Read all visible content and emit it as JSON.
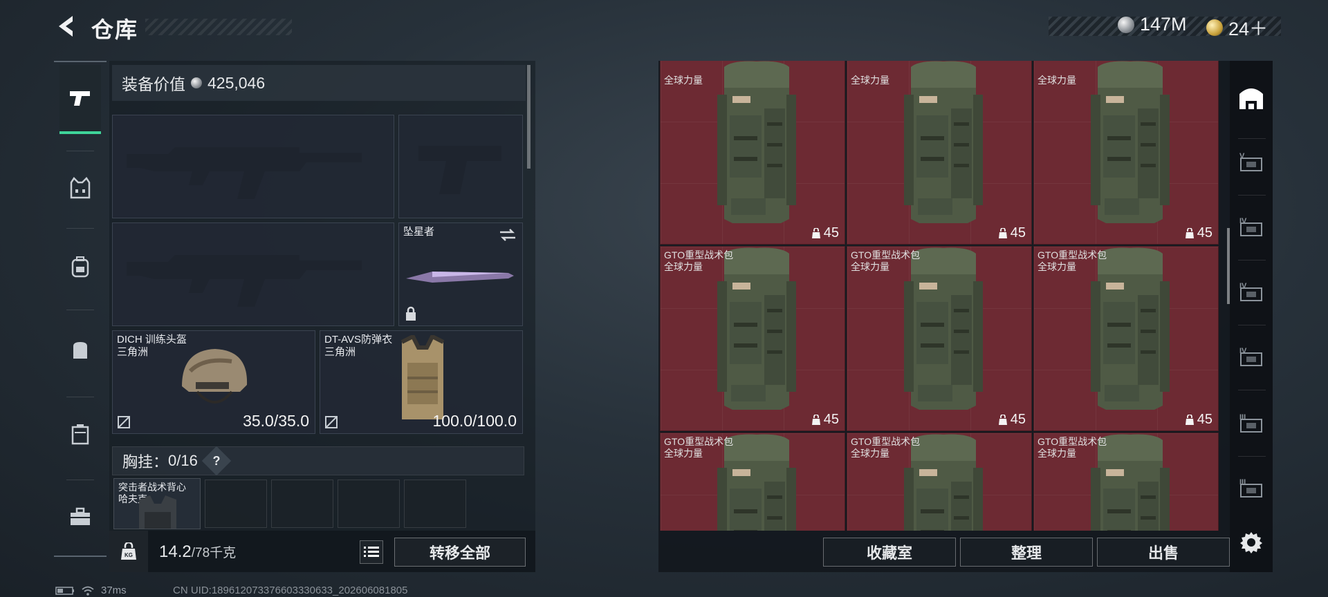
{
  "header": {
    "title": "仓库",
    "currency_1": "147M",
    "currency_2": "24＋"
  },
  "equipment": {
    "value_label": "装备价值",
    "value": "425,046",
    "melee_name": "坠星者",
    "helmet_name": "DICH 训练头盔",
    "helmet_origin": "三角洲",
    "helmet_durability": "35.0/35.0",
    "armor_name": "DT-AVS防弹衣",
    "armor_origin": "三角洲",
    "armor_durability": "100.0/100.0",
    "chest_rig_label": "胸挂：",
    "chest_rig_capacity": "0/16",
    "chest_rig_help": "?",
    "vest_name": "突击者战术背心",
    "vest_origin": "哈夫克"
  },
  "weight": {
    "current": "14.2",
    "max": "/78千克"
  },
  "actions": {
    "transfer_all": "转移全部",
    "collection_room": "收藏室",
    "organize": "整理",
    "sell": "出售"
  },
  "storage": {
    "item_name": "GTO重型战术包",
    "item_origin": "全球力量",
    "item_count": "45",
    "cells": [
      {
        "name": "",
        "origin": "全球力量",
        "count": "45"
      },
      {
        "name": "",
        "origin": "全球力量",
        "count": "45"
      },
      {
        "name": "",
        "origin": "全球力量",
        "count": "45"
      },
      {
        "name": "GTO重型战术包",
        "origin": "全球力量",
        "count": "45"
      },
      {
        "name": "GTO重型战术包",
        "origin": "全球力量",
        "count": "45"
      },
      {
        "name": "GTO重型战术包",
        "origin": "全球力量",
        "count": "45"
      },
      {
        "name": "GTO重型战术包",
        "origin": "全球力量",
        "count": "45"
      },
      {
        "name": "GTO重型战术包",
        "origin": "全球力量",
        "count": "45"
      },
      {
        "name": "GTO重型战术包",
        "origin": "全球力量",
        "count": "45"
      }
    ],
    "bg_color": "#6d2a33"
  },
  "filters": {
    "levels": [
      "V",
      "IV",
      "IV",
      "IV",
      "III",
      "III"
    ]
  },
  "status": {
    "ping": "37ms",
    "uid": "CN UID:1896120733766033306​33_202606081805"
  },
  "colors": {
    "accent": "#3fd49a",
    "rarity_red": "#6d2a33"
  }
}
